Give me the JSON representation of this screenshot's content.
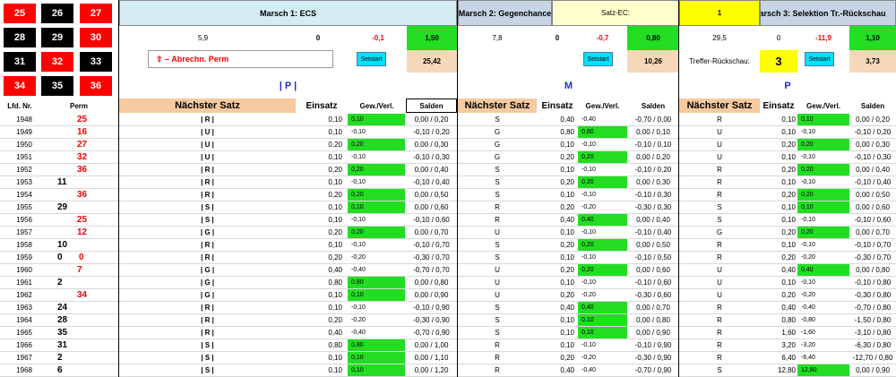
{
  "roulette_grid": [
    {
      "n": "25",
      "c": "red"
    },
    {
      "n": "26",
      "c": "black"
    },
    {
      "n": "27",
      "c": "red"
    },
    {
      "n": "28",
      "c": "black"
    },
    {
      "n": "29",
      "c": "black"
    },
    {
      "n": "30",
      "c": "red"
    },
    {
      "n": "31",
      "c": "black"
    },
    {
      "n": "32",
      "c": "red"
    },
    {
      "n": "33",
      "c": "black"
    },
    {
      "n": "34",
      "c": "red"
    },
    {
      "n": "35",
      "c": "black"
    },
    {
      "n": "36",
      "c": "red"
    }
  ],
  "marsch1": {
    "title": "Marsch 1: ECS",
    "v1": "5,9",
    "v2": "0",
    "v3": "-0,1",
    "v4": "1,50",
    "abrechn": "⇧ – Abrechn. Perm",
    "setstart": "Setstart",
    "saldo": "25,42",
    "group_label": "| P |"
  },
  "marsch2": {
    "title": "Marsch 2: Gegenchance",
    "satz_ec_label": "Satz-EC:",
    "satz_ec_value": "1",
    "v1": "7,8",
    "v2": "0",
    "v3": "-0,7",
    "v4": "0,80",
    "setstart": "Setstart",
    "saldo": "10,26",
    "group_label": "M"
  },
  "marsch3": {
    "title": "Marsch 3: Selektion Tr.-Rückschau",
    "v1": "29,5",
    "v2": "0",
    "v3": "-11,9",
    "v4": "1,10",
    "treffer_label": "Treffer-Rückschau:",
    "treffer_value": "3",
    "setstart": "Setstart",
    "saldo": "3,73",
    "group_label": "P"
  },
  "columns": {
    "lfd": "Lfd. Nr.",
    "perm": "Perm",
    "naechster": "Nächster Satz",
    "einsatz": "Einsatz",
    "gew": "Gew./Verl.",
    "salden": "Salden"
  },
  "rows": [
    {
      "lfd": "1948",
      "perm": "25",
      "pc": "r",
      "pcol": 1,
      "s1": "| R |",
      "e1": "0,10",
      "g1": "0,10",
      "g1g": true,
      "sa1": "0,00 / 0,20",
      "s2": "S",
      "e2": "0,40",
      "g2": "-0,40",
      "g2g": false,
      "sa2": "-0,70 / 0,00",
      "s3": "R",
      "e3": "0,10",
      "g3": "0,10",
      "g3g": true,
      "sa3": "0,00 / 0,20"
    },
    {
      "lfd": "1949",
      "perm": "16",
      "pc": "r",
      "pcol": 1,
      "s1": "| U |",
      "e1": "0,10",
      "g1": "-0,10",
      "g1g": false,
      "sa1": "-0,10 / 0,20",
      "s2": "G",
      "e2": "0,80",
      "g2": "0,80",
      "g2g": true,
      "sa2": "0,00 / 0,10",
      "s3": "U",
      "e3": "0,10",
      "g3": "-0,10",
      "g3g": false,
      "sa3": "-0,10 / 0,20"
    },
    {
      "lfd": "1950",
      "perm": "27",
      "pc": "r",
      "pcol": 1,
      "s1": "| U |",
      "e1": "0,20",
      "g1": "0,20",
      "g1g": true,
      "sa1": "0,00 / 0,30",
      "s2": "G",
      "e2": "0,10",
      "g2": "-0,10",
      "g2g": false,
      "sa2": "-0,10 / 0,10",
      "s3": "U",
      "e3": "0,20",
      "g3": "0,20",
      "g3g": true,
      "sa3": "0,00 / 0,30"
    },
    {
      "lfd": "1951",
      "perm": "32",
      "pc": "r",
      "pcol": 1,
      "s1": "| U |",
      "e1": "0,10",
      "g1": "-0,10",
      "g1g": false,
      "sa1": "-0,10 / 0,30",
      "s2": "G",
      "e2": "0,20",
      "g2": "0,20",
      "g2g": true,
      "sa2": "0,00 / 0,20",
      "s3": "U",
      "e3": "0,10",
      "g3": "-0,10",
      "g3g": false,
      "sa3": "-0,10 / 0,30"
    },
    {
      "lfd": "1952",
      "perm": "36",
      "pc": "r",
      "pcol": 1,
      "s1": "| R |",
      "e1": "0,20",
      "g1": "0,20",
      "g1g": true,
      "sa1": "0,00 / 0,40",
      "s2": "S",
      "e2": "0,10",
      "g2": "-0,10",
      "g2g": false,
      "sa2": "-0,10 / 0,20",
      "s3": "R",
      "e3": "0,20",
      "g3": "0,20",
      "g3g": true,
      "sa3": "0,00 / 0,40"
    },
    {
      "lfd": "1953",
      "perm": "11",
      "pc": "b",
      "pcol": 0,
      "s1": "| R |",
      "e1": "0,10",
      "g1": "-0,10",
      "g1g": false,
      "sa1": "-0,10 / 0,40",
      "s2": "S",
      "e2": "0,20",
      "g2": "0,20",
      "g2g": true,
      "sa2": "0,00 / 0,30",
      "s3": "R",
      "e3": "0,10",
      "g3": "-0,10",
      "g3g": false,
      "sa3": "-0,10 / 0,40"
    },
    {
      "lfd": "1954",
      "perm": "36",
      "pc": "r",
      "pcol": 1,
      "s1": "| R |",
      "e1": "0,20",
      "g1": "0,20",
      "g1g": true,
      "sa1": "0,00 / 0,50",
      "s2": "S",
      "e2": "0,10",
      "g2": "-0,10",
      "g2g": false,
      "sa2": "-0,10 / 0,30",
      "s3": "R",
      "e3": "0,20",
      "g3": "0,20",
      "g3g": true,
      "sa3": "0,00 / 0,50"
    },
    {
      "lfd": "1955",
      "perm": "29",
      "pc": "b",
      "pcol": 0,
      "s1": "| S |",
      "e1": "0,10",
      "g1": "0,10",
      "g1g": true,
      "sa1": "0,00 / 0,60",
      "s2": "R",
      "e2": "0,20",
      "g2": "-0,20",
      "g2g": false,
      "sa2": "-0,30 / 0,30",
      "s3": "S",
      "e3": "0,10",
      "g3": "0,10",
      "g3g": true,
      "sa3": "0,00 / 0,60"
    },
    {
      "lfd": "1956",
      "perm": "25",
      "pc": "r",
      "pcol": 1,
      "s1": "| S |",
      "e1": "0,10",
      "g1": "-0,10",
      "g1g": false,
      "sa1": "-0,10 / 0,60",
      "s2": "R",
      "e2": "0,40",
      "g2": "0,40",
      "g2g": true,
      "sa2": "0,00 / 0,40",
      "s3": "S",
      "e3": "0,10",
      "g3": "-0,10",
      "g3g": false,
      "sa3": "-0,10 / 0,60"
    },
    {
      "lfd": "1957",
      "perm": "12",
      "pc": "r",
      "pcol": 1,
      "s1": "| G |",
      "e1": "0,20",
      "g1": "0,20",
      "g1g": true,
      "sa1": "0,00 / 0,70",
      "s2": "U",
      "e2": "0,10",
      "g2": "-0,10",
      "g2g": false,
      "sa2": "-0,10 / 0,40",
      "s3": "G",
      "e3": "0,20",
      "g3": "0,20",
      "g3g": true,
      "sa3": "0,00 / 0,70"
    },
    {
      "lfd": "1958",
      "perm": "10",
      "pc": "b",
      "pcol": 0,
      "s1": "| R |",
      "e1": "0,10",
      "g1": "-0,10",
      "g1g": false,
      "sa1": "-0,10 / 0,70",
      "s2": "S",
      "e2": "0,20",
      "g2": "0,20",
      "g2g": true,
      "sa2": "0,00 / 0,50",
      "s3": "R",
      "e3": "0,10",
      "g3": "-0,10",
      "g3g": false,
      "sa3": "-0,10 / 0,70"
    },
    {
      "lfd": "1959",
      "perm": "0",
      "perm2": "0",
      "pc": "b",
      "pcol": 0,
      "s1": "| R |",
      "e1": "0,20",
      "g1": "-0,20",
      "g1g": false,
      "sa1": "-0,30 / 0,70",
      "s2": "S",
      "e2": "0,10",
      "g2": "-0,10",
      "g2g": false,
      "sa2": "-0,10 / 0,50",
      "s3": "R",
      "e3": "0,20",
      "g3": "-0,20",
      "g3g": false,
      "sa3": "-0,30 / 0,70"
    },
    {
      "lfd": "1960",
      "perm": "7",
      "pc": "r",
      "pcol": 1,
      "s1": "| G |",
      "e1": "0,40",
      "g1": "-0,40",
      "g1g": false,
      "sa1": "-0,70 / 0,70",
      "s2": "U",
      "e2": "0,20",
      "g2": "0,20",
      "g2g": true,
      "sa2": "0,00 / 0,60",
      "s3": "U",
      "e3": "0,40",
      "g3": "0,40",
      "g3g": true,
      "sa3": "0,00 / 0,80"
    },
    {
      "lfd": "1961",
      "perm": "2",
      "pc": "b",
      "pcol": 0,
      "s1": "| G |",
      "e1": "0,80",
      "g1": "0,80",
      "g1g": true,
      "sa1": "0,00 / 0,80",
      "s2": "U",
      "e2": "0,10",
      "g2": "-0,10",
      "g2g": false,
      "sa2": "-0,10 / 0,60",
      "s3": "U",
      "e3": "0,10",
      "g3": "-0,10",
      "g3g": false,
      "sa3": "-0,10 / 0,80"
    },
    {
      "lfd": "1962",
      "perm": "34",
      "pc": "r",
      "pcol": 1,
      "s1": "| G |",
      "e1": "0,10",
      "g1": "0,10",
      "g1g": true,
      "sa1": "0,00 / 0,90",
      "s2": "U",
      "e2": "0,20",
      "g2": "-0,20",
      "g2g": false,
      "sa2": "-0,30 / 0,60",
      "s3": "U",
      "e3": "0,20",
      "g3": "-0,20",
      "g3g": false,
      "sa3": "-0,30 / 0,80"
    },
    {
      "lfd": "1963",
      "perm": "24",
      "pc": "b",
      "pcol": 0,
      "s1": "| R |",
      "e1": "0,10",
      "g1": "-0,10",
      "g1g": false,
      "sa1": "-0,10 / 0,90",
      "s2": "S",
      "e2": "0,40",
      "g2": "0,40",
      "g2g": true,
      "sa2": "0,00 / 0,70",
      "s3": "R",
      "e3": "0,40",
      "g3": "-0,40",
      "g3g": false,
      "sa3": "-0,70 / 0,80"
    },
    {
      "lfd": "1964",
      "perm": "28",
      "pc": "b",
      "pcol": 0,
      "s1": "| R |",
      "e1": "0,20",
      "g1": "-0,20",
      "g1g": false,
      "sa1": "-0,30 / 0,90",
      "s2": "S",
      "e2": "0,10",
      "g2": "0,10",
      "g2g": true,
      "sa2": "0,00 / 0,80",
      "s3": "R",
      "e3": "0,80",
      "g3": "-0,80",
      "g3g": false,
      "sa3": "-1,50 / 0,80"
    },
    {
      "lfd": "1965",
      "perm": "35",
      "pc": "b",
      "pcol": 0,
      "s1": "| R |",
      "e1": "0,40",
      "g1": "-0,40",
      "g1g": false,
      "sa1": "-0,70 / 0,90",
      "s2": "S",
      "e2": "0,10",
      "g2": "0,10",
      "g2g": true,
      "sa2": "0,00 / 0,90",
      "s3": "R",
      "e3": "1,60",
      "g3": "-1,60",
      "g3g": false,
      "sa3": "-3,10 / 0,80"
    },
    {
      "lfd": "1966",
      "perm": "31",
      "pc": "b",
      "pcol": 0,
      "s1": "| S |",
      "e1": "0,80",
      "g1": "0,80",
      "g1g": true,
      "sa1": "0,00 / 1,00",
      "s2": "R",
      "e2": "0,10",
      "g2": "-0,10",
      "g2g": false,
      "sa2": "-0,10 / 0,90",
      "s3": "R",
      "e3": "3,20",
      "g3": "-3,20",
      "g3g": false,
      "sa3": "-6,30 / 0,80"
    },
    {
      "lfd": "1967",
      "perm": "2",
      "pc": "b",
      "pcol": 0,
      "s1": "| S |",
      "e1": "0,10",
      "g1": "0,10",
      "g1g": true,
      "sa1": "0,00 / 1,10",
      "s2": "R",
      "e2": "0,20",
      "g2": "-0,20",
      "g2g": false,
      "sa2": "-0,30 / 0,90",
      "s3": "R",
      "e3": "6,40",
      "g3": "-6,40",
      "g3g": false,
      "sa3": "-12,70 / 0,80"
    },
    {
      "lfd": "1968",
      "perm": "6",
      "pc": "b",
      "pcol": 0,
      "s1": "| S |",
      "e1": "0,10",
      "g1": "0,10",
      "g1g": true,
      "sa1": "0,00 / 1,20",
      "s2": "R",
      "e2": "0,40",
      "g2": "-0,40",
      "g2g": false,
      "sa2": "-0,70 / 0,90",
      "s3": "S",
      "e3": "12,80",
      "g3": "12,80",
      "g3g": true,
      "sa3": "0,00 / 0,90"
    }
  ]
}
